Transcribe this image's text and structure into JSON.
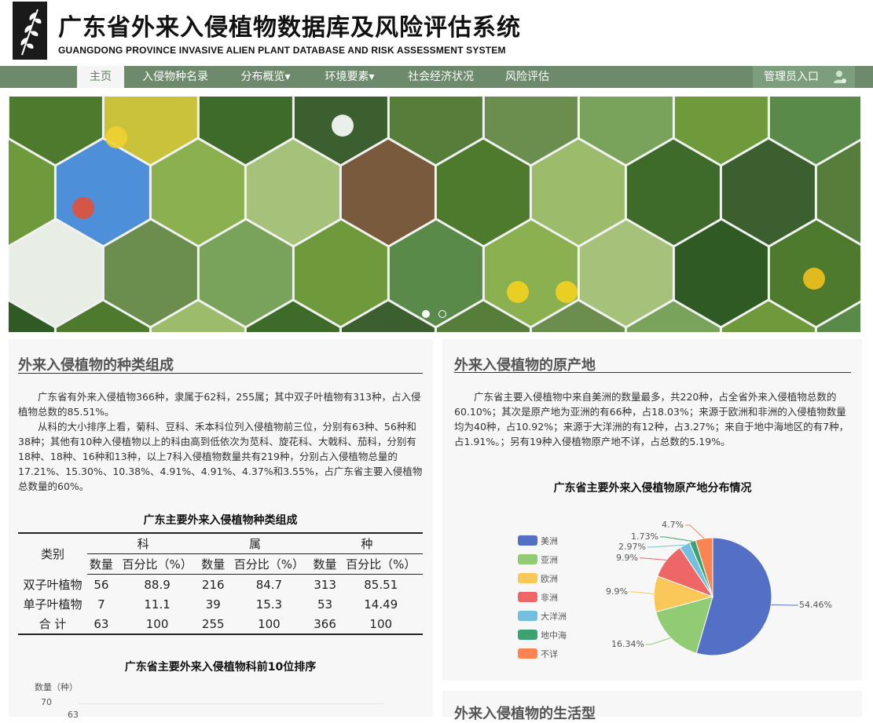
{
  "header": {
    "title_cn": "广东省外来入侵植物数据库及风险评估系统",
    "title_en": "GUANGDONG PROVINCE INVASIVE ALIEN PLANT DATABASE AND RISK ASSESSMENT SYSTEM"
  },
  "nav": {
    "items": [
      {
        "label": "主页",
        "active": true
      },
      {
        "label": "入侵物种名录"
      },
      {
        "label": "分布概览▾"
      },
      {
        "label": "环境要素▾"
      },
      {
        "label": "社会经济状况"
      },
      {
        "label": "风险评估"
      }
    ],
    "admin_label": "管理员入口"
  },
  "banner": {
    "slide_count": 2,
    "active_slide": 1
  },
  "species": {
    "title": "外来入侵植物的种类组成",
    "para1": "广东省有外来入侵植物366种，隶属于62科，255属；其中双子叶植物有313种，占入侵植物总数的85.51%。",
    "para2": "从科的大小排序上看，菊科、豆科、禾本科位列入侵植物前三位，分别有63种、56种和38种；其他有10种入侵植物以上的科由高到低依次为苋科、旋花科、大戟科、茄科，分别有18种、18种、16种和13种，以上7科入侵植物数量共有219种，分别占入侵植物总量的17.21%、15.30%、10.38%、4.91%、4.91%、4.37%和3.55%，占广东省主要入侵植物总数量的60%。",
    "table": {
      "title": "广东主要外来入侵植物种类组成",
      "col_category": "类别",
      "groups": [
        "科",
        "属",
        "种"
      ],
      "sub_count": "数量",
      "sub_pct": "百分比（%）",
      "rows": [
        [
          "双子叶植物",
          "56",
          "88.9",
          "216",
          "84.7",
          "313",
          "85.51"
        ],
        [
          "单子叶植物",
          "7",
          "11.1",
          "39",
          "15.3",
          "53",
          "14.49"
        ],
        [
          "合 计",
          "63",
          "100",
          "255",
          "100",
          "366",
          "100"
        ]
      ]
    },
    "chart2": {
      "title": "广东省主要外来入侵植物科前10位排序",
      "ylabel": "数量（种）",
      "tick_top": "70",
      "first_value": "63"
    }
  },
  "origin": {
    "title": "外来入侵植物的原产地",
    "para": "广东省主要入侵植物中来自美洲的数量最多，共220种，占全省外来入侵植物总数的60.10%；其次是原产地为亚洲的有66种，占18.03%；来源于欧洲和非洲的入侵植物数量均为40种，占10.92%；来源于大洋洲的有12种，占3.27%；来自于地中海地区的有7种，占1.91%。；另有19种入侵植物原产地不详，占总数的5.19%。"
  },
  "lifeform": {
    "title": "外来入侵植物的生活型"
  },
  "chart_data": {
    "type": "pie",
    "title": "广东省主要外来入侵植物原产地分布情况",
    "slices": [
      {
        "name": "美洲",
        "value": 54.46,
        "label": "54.46%",
        "color": "#5470c6"
      },
      {
        "name": "亚洲",
        "value": 16.34,
        "label": "16.34%",
        "color": "#91cc75"
      },
      {
        "name": "欧洲",
        "value": 9.9,
        "label": "9.9%",
        "color": "#fac858"
      },
      {
        "name": "非洲",
        "value": 9.9,
        "label": "9.9%",
        "color": "#ee6666"
      },
      {
        "name": "大洋洲",
        "value": 2.97,
        "label": "2.97%",
        "color": "#73c0de"
      },
      {
        "name": "地中海",
        "value": 1.73,
        "label": "1.73%",
        "color": "#3ba272"
      },
      {
        "name": "不详",
        "value": 4.7,
        "label": "4.7%",
        "color": "#fc8452"
      }
    ],
    "legend_position": "left"
  }
}
